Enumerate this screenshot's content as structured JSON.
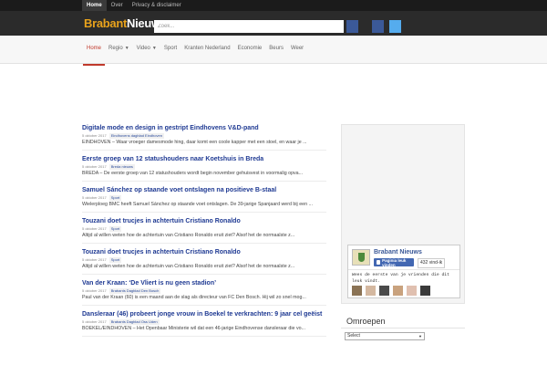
{
  "topbar": {
    "links": [
      "Home",
      "Over",
      "Privacy & disclaimer"
    ]
  },
  "logo": {
    "part1": "Brabant",
    "part2": "Nieuws"
  },
  "search": {
    "placeholder": "Zoek..."
  },
  "colors": {
    "accent": "#c0392b",
    "logo_orange": "#e8a21c",
    "facebook": "#3b5998",
    "twitter": "#55acee",
    "title_blue": "#1f3a93"
  },
  "social": [
    {
      "icon": "facebook-icon",
      "color": "#3b5998"
    },
    {
      "icon": "twitter-icon",
      "color": "#55acee"
    }
  ],
  "nav": {
    "items": [
      {
        "label": "Home",
        "active": true,
        "dropdown": false
      },
      {
        "label": "Regio",
        "active": false,
        "dropdown": true
      },
      {
        "label": "Video",
        "active": false,
        "dropdown": true
      },
      {
        "label": "Sport",
        "active": false,
        "dropdown": false
      },
      {
        "label": "Kranten Nederland",
        "active": false,
        "dropdown": false
      },
      {
        "label": "Economie",
        "active": false,
        "dropdown": false
      },
      {
        "label": "Beurs",
        "active": false,
        "dropdown": false
      },
      {
        "label": "Weer",
        "active": false,
        "dropdown": false
      }
    ]
  },
  "articles": [
    {
      "title": "Digitale mode en design in gestript Eindhovens V&D-pand",
      "date": "5 oktober 2017",
      "source": "Eindhovens dagblad Eindhoven",
      "excerpt": "EINDHOVEN – Waar vroeger damesmode hing, daar komt een coole kapper met een stoel, en waar je ..."
    },
    {
      "title": "Eerste groep van 12 statushouders naar Koetshuis in Breda",
      "date": "5 oktober 2017",
      "source": "Breda nieuws",
      "excerpt": "BREDA – De eerste groep van 12 statushouders wordt begin november gehuisvest in voormalig opva..."
    },
    {
      "title": "Samuel Sánchez op staande voet ontslagen na positieve B-staal",
      "date": "5 oktober 2017",
      "source": "Sport",
      "excerpt": "Wielerploeg BMC heeft Samuel Sánchez op staande voet ontslagen. De 39-jarige Spanjaard werd bij een ..."
    },
    {
      "title": "Touzani doet trucjes in achtertuin Cristiano Ronaldo",
      "date": "5 oktober 2017",
      "source": "Sport",
      "excerpt": "Altijd al willen weten hoe de achtertuin van Cristiano Ronaldo eruit ziet? Alsof het de normaalste z..."
    },
    {
      "title": "Touzani doet trucjes in achtertuin Cristiano Ronaldo",
      "date": "5 oktober 2017",
      "source": "Sport",
      "excerpt": "Altijd al willen weten hoe de achtertuin van Cristiano Ronaldo eruit ziet? Alsof het de normaalste z..."
    },
    {
      "title": "Van der Kraan: ‘De Vliert is nu geen stadion’",
      "date": "5 oktober 2017",
      "source": "Brabants Dagblad Den Bosch",
      "excerpt": "Paul van der Kraan (60) is een maand aan de slag als directeur van FC Den Bosch. Hij wil zo snel mog..."
    },
    {
      "title": "Dansleraar (46) probeert jonge vrouw in Boekel te verkrachten: 9 jaar cel geëist",
      "date": "5 oktober 2017",
      "source": "Brabants Dagblad Oss Uden",
      "excerpt": "BOEKEL/EINDHOVEN – Het Openbaar Ministerie wil dat een 46-jarige Eindhovense dansleraar die vo..."
    }
  ],
  "facebook_box": {
    "page_name": "Brabant Nieuws",
    "like_label": "Paginia leuk vinden",
    "like_count": "432 vind-ik",
    "friends_text": "Wees de eerste van je vrienden die dit leuk vindt.",
    "face_colors": [
      "#8b7355",
      "#d4b8a0",
      "#4a4a4a",
      "#c9a27e",
      "#e0c0b0",
      "#3a3a3a"
    ]
  },
  "omroepen": {
    "title": "Omroepen",
    "select_value": "Select"
  }
}
